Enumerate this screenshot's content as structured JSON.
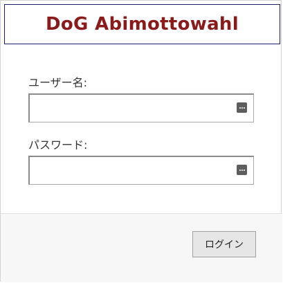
{
  "app": {
    "title": "DoG Abimottowahl"
  },
  "form": {
    "username_label": "ユーザー名:",
    "username_value": "",
    "password_label": "パスワード:",
    "password_value": ""
  },
  "icons": {
    "username_field_icon": "password-manager-key-icon",
    "password_field_icon": "password-manager-key-icon"
  },
  "footer": {
    "login_label": "ログイン"
  },
  "colors": {
    "title": "#8b1a1a",
    "title_border": "#1a1a6e",
    "footer_bg": "#f7f7f7",
    "button_bg": "#e6e6e6"
  }
}
